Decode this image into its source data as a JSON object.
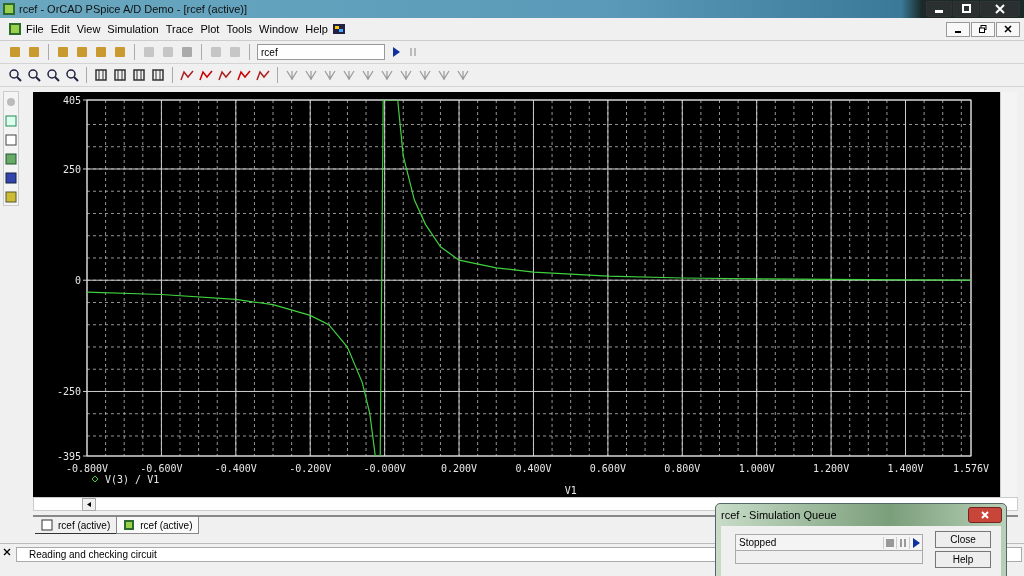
{
  "window": {
    "title": "rcef - OrCAD PSpice A/D Demo  - [rcef (active)]"
  },
  "menu": [
    "File",
    "Edit",
    "View",
    "Simulation",
    "Trace",
    "Plot",
    "Tools",
    "Window",
    "Help"
  ],
  "toolbar": {
    "profile": "rcef"
  },
  "plot": {
    "chart_data": {
      "type": "line",
      "grid": true,
      "xlabel": "V1",
      "xlim": [
        -0.8,
        1.576
      ],
      "ylim": [
        -395,
        405
      ],
      "xticks": [
        {
          "value": -0.8,
          "label": "-0.800V"
        },
        {
          "value": -0.6,
          "label": "-0.600V"
        },
        {
          "value": -0.4,
          "label": "-0.400V"
        },
        {
          "value": -0.2,
          "label": "-0.200V"
        },
        {
          "value": 0,
          "label": "-0.000V"
        },
        {
          "value": 0.2,
          "label": "0.200V"
        },
        {
          "value": 0.4,
          "label": "0.400V"
        },
        {
          "value": 0.6,
          "label": "0.600V"
        },
        {
          "value": 0.8,
          "label": "0.800V"
        },
        {
          "value": 1.0,
          "label": "1.000V"
        },
        {
          "value": 1.2,
          "label": "1.200V"
        },
        {
          "value": 1.4,
          "label": "1.400V"
        },
        {
          "value": 1.576,
          "label": "1.576V"
        }
      ],
      "yticks": [
        405,
        250,
        0,
        -250,
        -395
      ],
      "x": [
        -0.8,
        -0.6,
        -0.4,
        -0.3,
        -0.2,
        -0.15,
        -0.1,
        -0.06,
        -0.04,
        -0.025,
        -0.012,
        -0.004,
        0.035,
        0.05,
        0.08,
        0.11,
        0.15,
        0.2,
        0.3,
        0.4,
        0.6,
        0.8,
        1.0,
        1.2,
        1.4,
        1.576
      ],
      "series": [
        {
          "name": "V(3) / V1",
          "color": "#40d040",
          "values": [
            -27,
            -32,
            -43,
            -55,
            -79,
            -100,
            -150,
            -230,
            -300,
            -395,
            -395,
            405,
            405,
            280,
            180,
            125,
            75,
            45,
            28,
            18,
            9,
            5,
            3,
            2,
            1,
            0
          ]
        }
      ]
    }
  },
  "tabs": [
    {
      "label": "rcef (active)",
      "selected": false
    },
    {
      "label": "rcef (active)",
      "selected": true
    }
  ],
  "status": {
    "message": "Reading and checking circuit"
  },
  "queue": {
    "title": "rcef - Simulation Queue",
    "state": "Stopped",
    "buttons": [
      "Close",
      "Help"
    ]
  }
}
